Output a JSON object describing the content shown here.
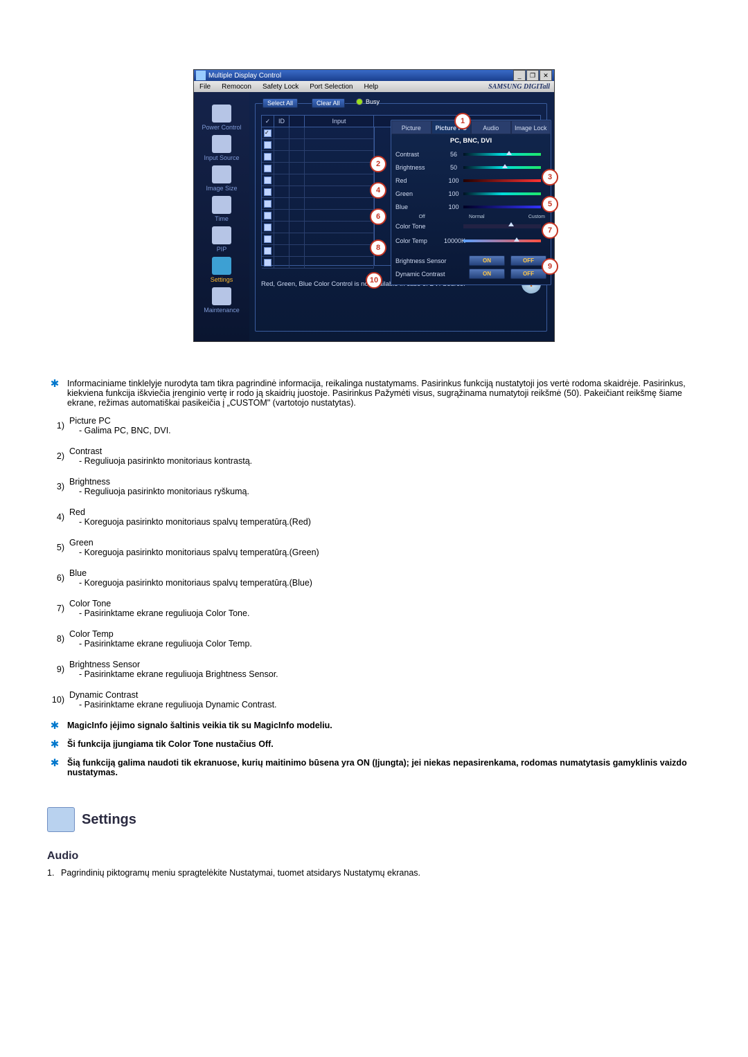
{
  "app_window": {
    "title": "Multiple Display Control",
    "menus": [
      "File",
      "Remocon",
      "Safety Lock",
      "Port Selection",
      "Help"
    ],
    "brand": "SAMSUNG DIGITall"
  },
  "sidebar": {
    "items": [
      {
        "label": "Power Control"
      },
      {
        "label": "Input Source"
      },
      {
        "label": "Image Size"
      },
      {
        "label": "Time"
      },
      {
        "label": "PIP"
      },
      {
        "label": "Settings"
      },
      {
        "label": "Maintenance"
      }
    ]
  },
  "panel": {
    "select_all": "Select All",
    "clear_all": "Clear All",
    "busy": "Busy",
    "columns": {
      "c0": "✓",
      "c1": "ID",
      "c2": "",
      "c3": "Input"
    },
    "note": "Red, Green, Blue Color Control is not available in case of DVI Source."
  },
  "tabs": [
    "Picture",
    "Picture PC",
    "Audio",
    "Image Lock"
  ],
  "active_tab": "Picture PC",
  "sub_header": "PC, BNC, DVI",
  "controls": {
    "contrast": {
      "label": "Contrast",
      "value": "56"
    },
    "brightness": {
      "label": "Brightness",
      "value": "50"
    },
    "red": {
      "label": "Red",
      "value": "100"
    },
    "green": {
      "label": "Green",
      "value": "100"
    },
    "blue": {
      "label": "Blue",
      "value": "100"
    },
    "color_tone": {
      "label": "Color Tone",
      "opts": [
        "",
        "Off",
        "",
        "Normal",
        "",
        "Custom"
      ]
    },
    "color_temp": {
      "label": "Color Temp",
      "value": "10000K"
    },
    "brightness_sensor": {
      "label": "Brightness Sensor",
      "on": "ON",
      "off": "OFF"
    },
    "dynamic_contrast": {
      "label": "Dynamic Contrast",
      "on": "ON",
      "off": "OFF"
    }
  },
  "bubbles": {
    "b1": "1",
    "b2": "2",
    "b3": "3",
    "b4": "4",
    "b5": "5",
    "b6": "6",
    "b7": "7",
    "b8": "8",
    "b9": "9",
    "b10": "10"
  },
  "notes_intro": "Informaciniame tinklelyje nurodyta tam tikra pagrindinė informacija, reikalinga nustatymams. Pasirinkus funkciją nustatytoji jos vertė rodoma skaidrėje. Pasirinkus, kiekviena funkcija iškviečia įrenginio vertę ir rodo ją skaidrių juostoje. Pasirinkus Pažymėti visus, sugrąžinama numatytoji reikšmė (50). Pakeičiant reikšmę šiame ekrane, režimas automatiškai pasikeičia į „CUSTOM\" (vartotojo nustatytas).",
  "list": [
    {
      "n": "1)",
      "title": "Picture PC",
      "desc": "- Galima PC, BNC, DVI."
    },
    {
      "n": "2)",
      "title": "Contrast",
      "desc": "- Reguliuoja pasirinkto monitoriaus kontrastą."
    },
    {
      "n": "3)",
      "title": "Brightness",
      "desc": "- Reguliuoja pasirinkto monitoriaus ryškumą."
    },
    {
      "n": "4)",
      "title": "Red",
      "desc": "- Koreguoja pasirinkto monitoriaus spalvų temperatūrą.(Red)"
    },
    {
      "n": "5)",
      "title": "Green",
      "desc": "- Koreguoja pasirinkto monitoriaus spalvų temperatūrą.(Green)"
    },
    {
      "n": "6)",
      "title": "Blue",
      "desc": "- Koreguoja pasirinkto monitoriaus spalvų temperatūrą.(Blue)"
    },
    {
      "n": "7)",
      "title": "Color Tone",
      "desc": "- Pasirinktame ekrane reguliuoja Color Tone."
    },
    {
      "n": "8)",
      "title": "Color Temp",
      "desc": "- Pasirinktame ekrane reguliuoja Color Temp."
    },
    {
      "n": "9)",
      "title": "Brightness Sensor",
      "desc": "- Pasirinktame ekrane reguliuoja Brightness Sensor."
    },
    {
      "n": "10)",
      "title": "Dynamic Contrast",
      "desc": "- Pasirinktame ekrane reguliuoja Dynamic Contrast."
    }
  ],
  "star_notes": [
    "MagicInfo įėjimo signalo šaltinis veikia tik su MagicInfo modeliu.",
    "Ši funkcija įjungiama tik Color Tone nustačius Off.",
    "Šią funkciją galima naudoti tik ekranuose, kurių maitinimo būsena yra ON (Įjungta); jei niekas nepasirenkama, rodomas numatytasis gamyklinis vaizdo nustatymas."
  ],
  "section": {
    "title": "Settings",
    "sub": "Audio"
  },
  "steps": [
    {
      "n": "1.",
      "text": "Pagrindinių piktogramų meniu spragtelėkite Nustatymai, tuomet atsidarys Nustatymų ekranas."
    }
  ]
}
